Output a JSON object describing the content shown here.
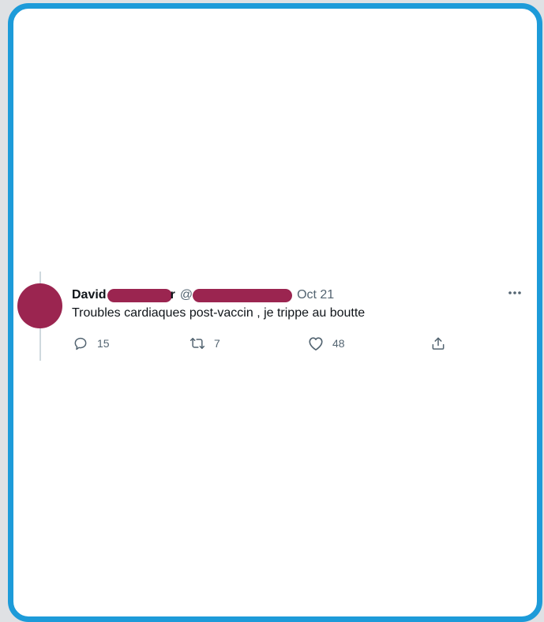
{
  "tweet": {
    "display_name": "David",
    "name_tail": "r",
    "handle_prefix": "@",
    "date": "Oct 21",
    "text": "Troubles cardiaques post-vaccin , je trippe au boutte",
    "more_icon": "more-dots-icon",
    "avatar_color": "#9b2550",
    "redaction_color": "#9b2550"
  },
  "actions": {
    "reply": {
      "icon": "reply-icon",
      "count": "15"
    },
    "retweet": {
      "icon": "retweet-icon",
      "count": "7"
    },
    "like": {
      "icon": "heart-icon",
      "count": "48"
    },
    "share": {
      "icon": "share-icon"
    }
  },
  "colors": {
    "frame_border": "#1d9bd9",
    "text_primary": "#0f1419",
    "text_secondary": "#536471"
  }
}
